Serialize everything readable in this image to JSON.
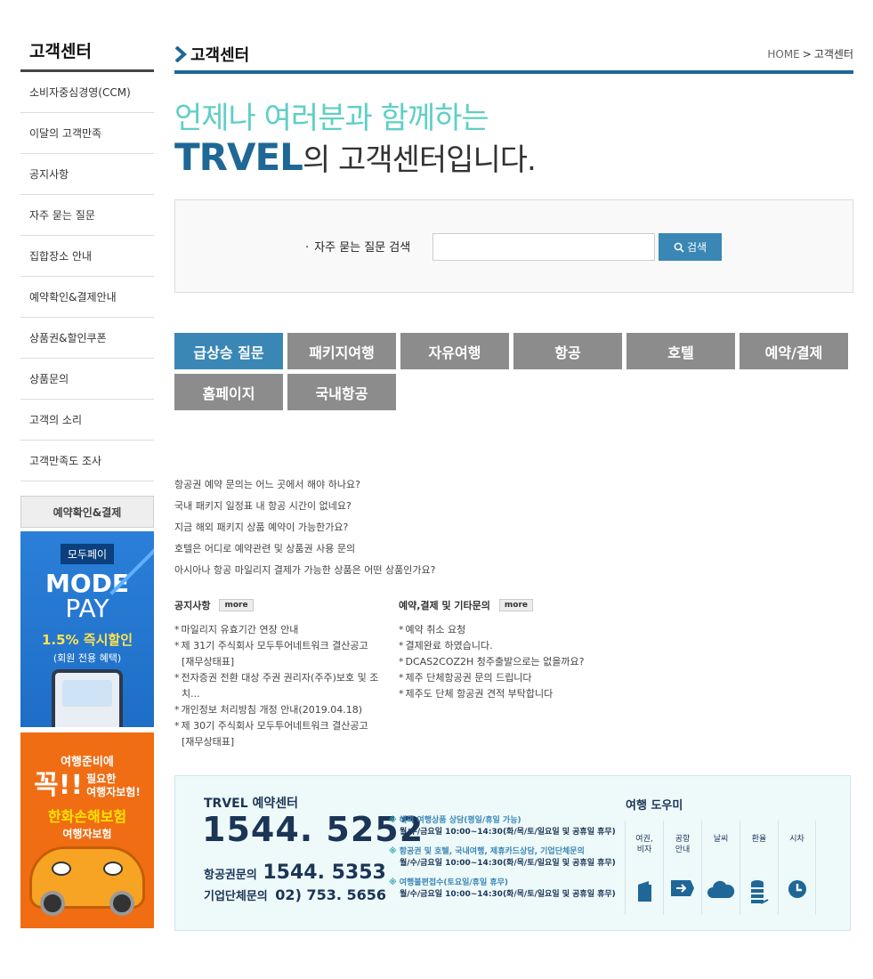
{
  "sidebar": {
    "title": "고객센터",
    "items": [
      {
        "label": "소비자중심경영(CCM)"
      },
      {
        "label": "이달의 고객만족"
      },
      {
        "label": "공지사항"
      },
      {
        "label": "자주 묻는 질문"
      },
      {
        "label": "집합장소 안내"
      },
      {
        "label": "예약확인&결제안내"
      },
      {
        "label": "상품권&할인쿠폰"
      },
      {
        "label": "상품문의"
      },
      {
        "label": "고객의 소리"
      },
      {
        "label": "고객만족도 조사"
      }
    ],
    "box_button": "예약확인&결제",
    "banner_modepay": {
      "tag": "모두페이",
      "big": "MODE",
      "pay": "PAY",
      "pct": "1.5% 즉시할인",
      "sub": "(회원 전용 혜택)"
    },
    "banner_insure": {
      "line1": "여행준비에",
      "kkok": "꼭!!",
      "need1": "필요한",
      "need2": "여행자보험!",
      "brand": "한화손해보험",
      "brand2": "여행자보험"
    }
  },
  "header": {
    "title": "고객센터",
    "breadcrumb_home": "HOME",
    "breadcrumb_sep": ">",
    "breadcrumb_current": "고객센터"
  },
  "hero": {
    "line1": "언제나 여러분과 함께하는",
    "brand": "TRVEL",
    "line2_rest": "의 고객센터입니다."
  },
  "search": {
    "label": "자주 묻는 질문 검색",
    "placeholder": "",
    "button": "검색"
  },
  "categories": [
    {
      "label": "급상승 질문",
      "active": true
    },
    {
      "label": "패키지여행",
      "active": false
    },
    {
      "label": "자유여행",
      "active": false
    },
    {
      "label": "항공",
      "active": false
    },
    {
      "label": "호텔",
      "active": false
    },
    {
      "label": "예약/결제",
      "active": false
    },
    {
      "label": "홈페이지",
      "active": false
    },
    {
      "label": "국내항공",
      "active": false
    }
  ],
  "faq": [
    "항공권 예약 문의는 어느 곳에서 해야 하나요?",
    "국내 패키지 일정표 내 항공 시간이 없네요?",
    "지금 해외 패키지 상품 예약이 가능한가요?",
    "호텔은 어디로 예약관련 및 상품권 사용 문의",
    "아시아나 항공 마일리지 결제가 가능한 상품은 어떤 상품인가요?"
  ],
  "notice_board": {
    "title": "공지사항",
    "more": "more",
    "items": [
      {
        "text": "마일리지 유효기간 연장 안내",
        "cont": ""
      },
      {
        "text": "제 31기 주식회사 모두투어네트워크 결산공고",
        "cont": "[재무상태표]"
      },
      {
        "text": "전자증권 전환 대상 주권 권리자(주주)보호 및 조",
        "cont": "치..."
      },
      {
        "text": "개인정보 처리방침 개정 안내(2019.04.18)",
        "cont": ""
      },
      {
        "text": "제 30기 주식회사 모두투어네트워크 결산공고",
        "cont": "[재무상태표]"
      }
    ]
  },
  "etc_board": {
    "title": "예약,결제 및 기타문의",
    "more": "more",
    "items": [
      "예약 취소 요청",
      "결제완료 하였습니다.",
      "DCAS2COZ2H 청주출발으로는 없을까요?",
      "제주 단체항공권 문의 드립니다",
      "제주도 단체 항공권 견적 부탁합니다"
    ]
  },
  "center": {
    "title": "TRVEL 예약센터",
    "phone": "1544. 5252",
    "air_label": "항공권문의",
    "air_num": "1544. 5353",
    "corp_label": "기업단체문의",
    "corp_num": "02) 753. 5656",
    "notes": [
      {
        "mark": "※",
        "head": "해외 여행상품 상담(평일/휴일 가능)",
        "text": "월/수/금요일 10:00~14:30(화/목/토/일요일 및 공휴일 휴무)"
      },
      {
        "mark": "※",
        "head": "항공권 및 호텔, 국내여행, 제휴카드상담, 기업단체문의",
        "text": "월/수/금요일 10:00~14:30(화/목/토/일요일 및 공휴일 휴무)"
      },
      {
        "mark": "※",
        "head": "여행불편접수(토요일/휴일 휴무)",
        "text": "월/수/금요일 10:00~14:30(화/목/토/일요일 및 공휴일 휴무)"
      }
    ],
    "helper_title": "여행 도우미",
    "helpers": [
      {
        "l1": "여권,",
        "l2": "비자",
        "icon": "passport-icon"
      },
      {
        "l1": "공항",
        "l2": "안내",
        "icon": "airport-icon"
      },
      {
        "l1": "날씨",
        "l2": "",
        "icon": "weather-icon"
      },
      {
        "l1": "환율",
        "l2": "",
        "icon": "exchange-icon"
      },
      {
        "l1": "시차",
        "l2": "",
        "icon": "clock-icon"
      }
    ]
  },
  "colors": {
    "accent": "#1e6796",
    "button": "#3a87b6",
    "hero_green": "#5ecfc6",
    "category_gray": "#8c8c8c"
  }
}
